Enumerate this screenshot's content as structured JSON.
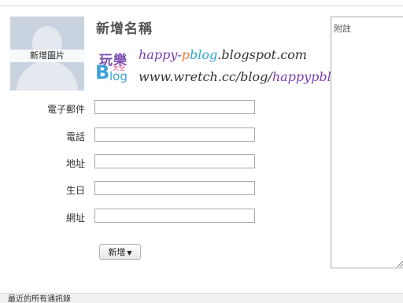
{
  "avatar": {
    "label": "新增圖片"
  },
  "contact": {
    "name_title": "新增名稱"
  },
  "watermark": {
    "cn_text": "玩樂",
    "b_letter": "B",
    "small_text": "大全",
    "log_text": "log",
    "url1_part1": "happy-",
    "url1_part2": "p",
    "url1_part3": "blog",
    "url1_part4": ".blogspot.com",
    "url2_part1": "www.wretch.cc/blog/",
    "url2_part2": "happypblog"
  },
  "form": {
    "fields": [
      {
        "label": "電子郵件",
        "value": ""
      },
      {
        "label": "電話",
        "value": ""
      },
      {
        "label": "地址",
        "value": ""
      },
      {
        "label": "生日",
        "value": ""
      },
      {
        "label": "網址",
        "value": ""
      }
    ],
    "add_button": "新增",
    "add_arrow": "▼"
  },
  "notes": {
    "label": "附註"
  },
  "bottom": {
    "text": "最近的所有通訊錄"
  },
  "colors": {
    "accent_purple": "#7a3fb4",
    "accent_orange": "#ef7a2a",
    "accent_cyan": "#2aa4d6"
  }
}
